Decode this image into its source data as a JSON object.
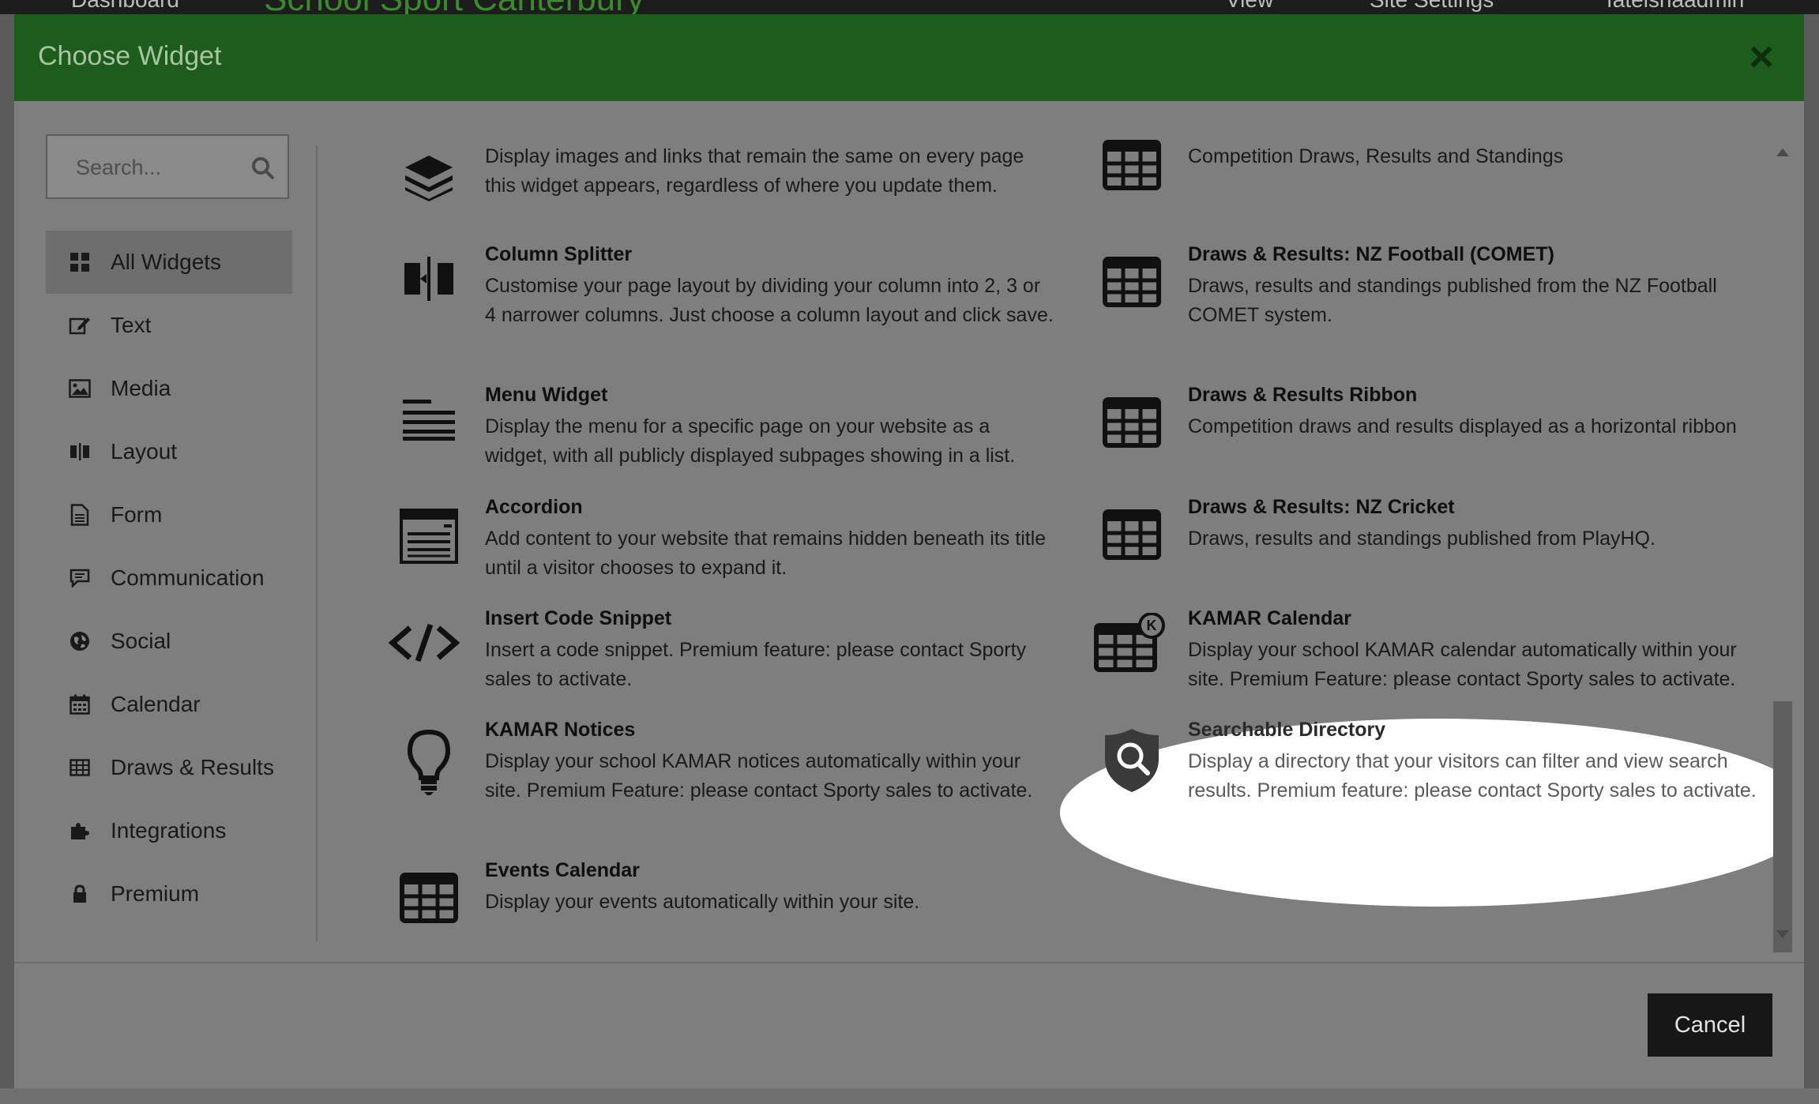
{
  "background": {
    "nav_dashboard": "Dashboard",
    "site_name": "School Sport Canterbury",
    "nav_view": "View",
    "nav_site_settings": "Site Settings",
    "user": "fatelshaadmin"
  },
  "modal": {
    "title": "Choose Widget",
    "close_label": "×",
    "cancel_label": "Cancel"
  },
  "search": {
    "placeholder": "Search..."
  },
  "sidebar": {
    "items": [
      {
        "label": "All Widgets",
        "icon": "grid-icon",
        "active": true
      },
      {
        "label": "Text",
        "icon": "edit-icon"
      },
      {
        "label": "Media",
        "icon": "image-icon"
      },
      {
        "label": "Layout",
        "icon": "columns-icon"
      },
      {
        "label": "Form",
        "icon": "document-icon"
      },
      {
        "label": "Communication",
        "icon": "chat-icon"
      },
      {
        "label": "Social",
        "icon": "globe-icon"
      },
      {
        "label": "Calendar",
        "icon": "calendar-icon"
      },
      {
        "label": "Draws & Results",
        "icon": "table-icon"
      },
      {
        "label": "Integrations",
        "icon": "puzzle-icon"
      },
      {
        "label": "Premium",
        "icon": "lock-icon"
      }
    ]
  },
  "widgets": {
    "left": [
      {
        "title": "",
        "desc": "Display images and links that remain the same on every page this widget appears, regardless of where you update them.",
        "icon": "layers-icon"
      },
      {
        "title": "Column Splitter",
        "desc": "Customise your page layout by dividing your column into 2, 3 or 4 narrower columns. Just choose a column layout and click save.",
        "icon": "column-splitter-icon"
      },
      {
        "title": "Menu Widget",
        "desc": "Display the menu for a specific page on your website as a widget, with all publicly displayed subpages showing in a list.",
        "icon": "menu-lines-icon"
      },
      {
        "title": "Accordion",
        "desc": "Add content to your website that remains hidden beneath its title until a visitor chooses to expand it.",
        "icon": "accordion-icon"
      },
      {
        "title": "Insert Code Snippet",
        "desc": "Insert a code snippet. Premium feature: please contact Sporty sales to activate.",
        "icon": "code-icon"
      },
      {
        "title": "KAMAR Notices",
        "desc": "Display your school KAMAR notices automatically within your site. Premium Feature: please contact Sporty sales to activate.",
        "icon": "lightbulb-icon"
      },
      {
        "title": "Events Calendar",
        "desc": "Display your events automatically within your site.",
        "icon": "table-icon"
      }
    ],
    "right": [
      {
        "title": "",
        "desc": "Competition Draws, Results and Standings",
        "icon": "table-icon"
      },
      {
        "title": "Draws & Results: NZ Football (COMET)",
        "desc": "Draws, results and standings published from the NZ Football COMET system.",
        "icon": "table-icon"
      },
      {
        "title": "Draws & Results Ribbon",
        "desc": "Competition draws and results displayed as a horizontal ribbon",
        "icon": "table-icon"
      },
      {
        "title": "Draws & Results: NZ Cricket",
        "desc": "Draws, results and standings published from PlayHQ.",
        "icon": "table-icon"
      },
      {
        "title": "KAMAR Calendar",
        "desc": "Display your school KAMAR calendar automatically within your site. Premium Feature: please contact Sporty sales to activate.",
        "icon": "kamar-calendar-icon",
        "badge": "K"
      },
      {
        "title": "Searchable Directory",
        "desc": "Display a directory that your visitors can filter and view search results. Premium feature: please contact Sporty sales to activate.",
        "icon": "shield-search-icon"
      }
    ]
  }
}
